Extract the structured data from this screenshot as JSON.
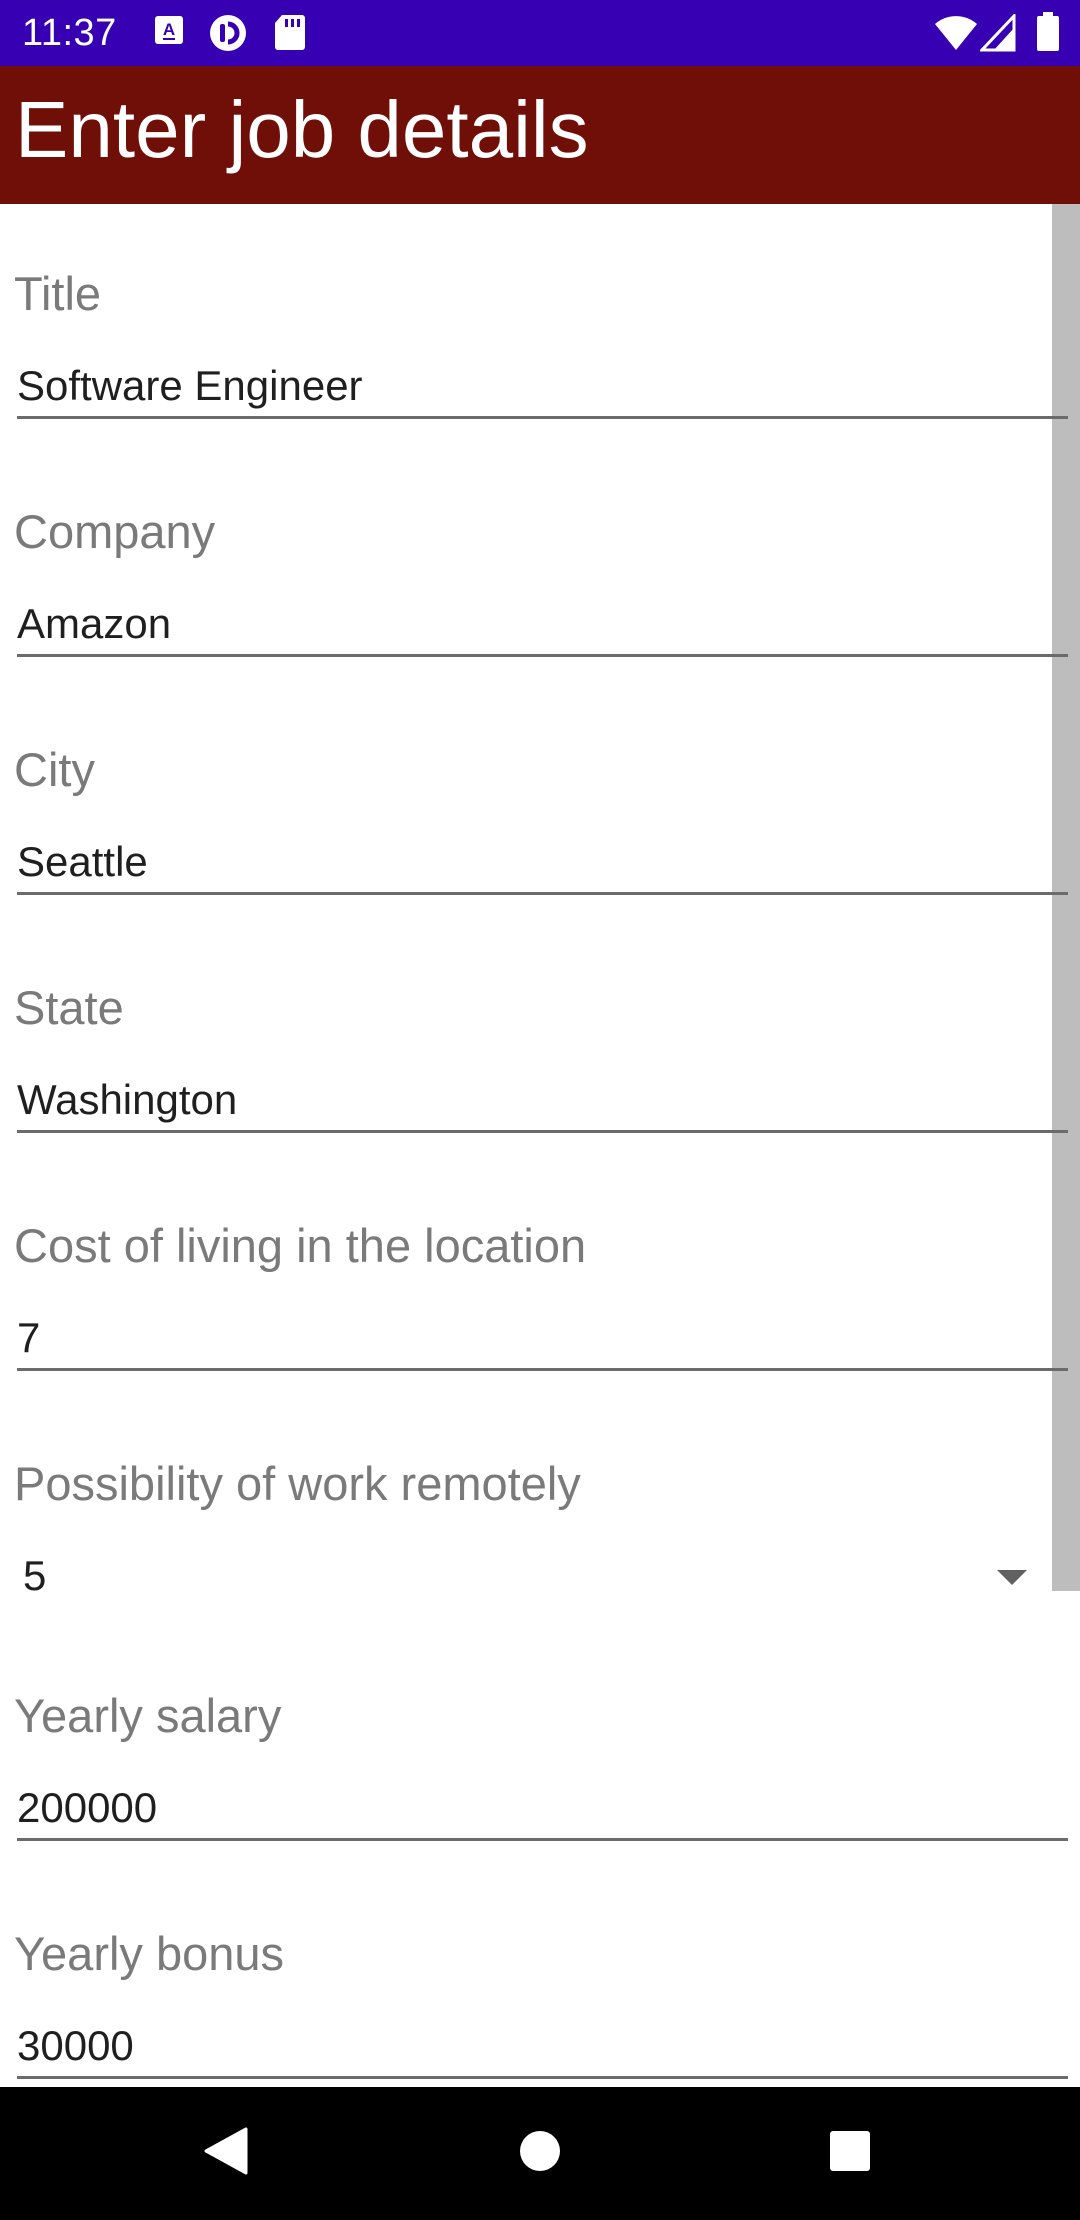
{
  "status_bar": {
    "time": "11:37",
    "left_icons": [
      "app-notification-icon",
      "pocket-casts-icon",
      "sd-card-icon"
    ],
    "right_icons": [
      "wifi-icon",
      "cellular-signal-icon",
      "battery-icon"
    ],
    "background_color": "#3700b3"
  },
  "toolbar": {
    "title": "Enter job details",
    "background_color": "#6f0f08"
  },
  "form": {
    "title": {
      "label": "Title",
      "value": "Software Engineer"
    },
    "company": {
      "label": "Company",
      "value": "Amazon"
    },
    "city": {
      "label": "City",
      "value": "Seattle"
    },
    "state": {
      "label": "State",
      "value": "Washington"
    },
    "cost_of_living": {
      "label": "Cost of living in the location",
      "value": "7"
    },
    "remote_work": {
      "label": "Possibility of work remotely",
      "selected": "5"
    },
    "yearly_salary": {
      "label": "Yearly salary",
      "value": "200000"
    },
    "yearly_bonus": {
      "label": "Yearly bonus",
      "value": "30000"
    }
  },
  "nav_bar": {
    "buttons": [
      "back-icon",
      "home-icon",
      "recents-icon"
    ]
  }
}
